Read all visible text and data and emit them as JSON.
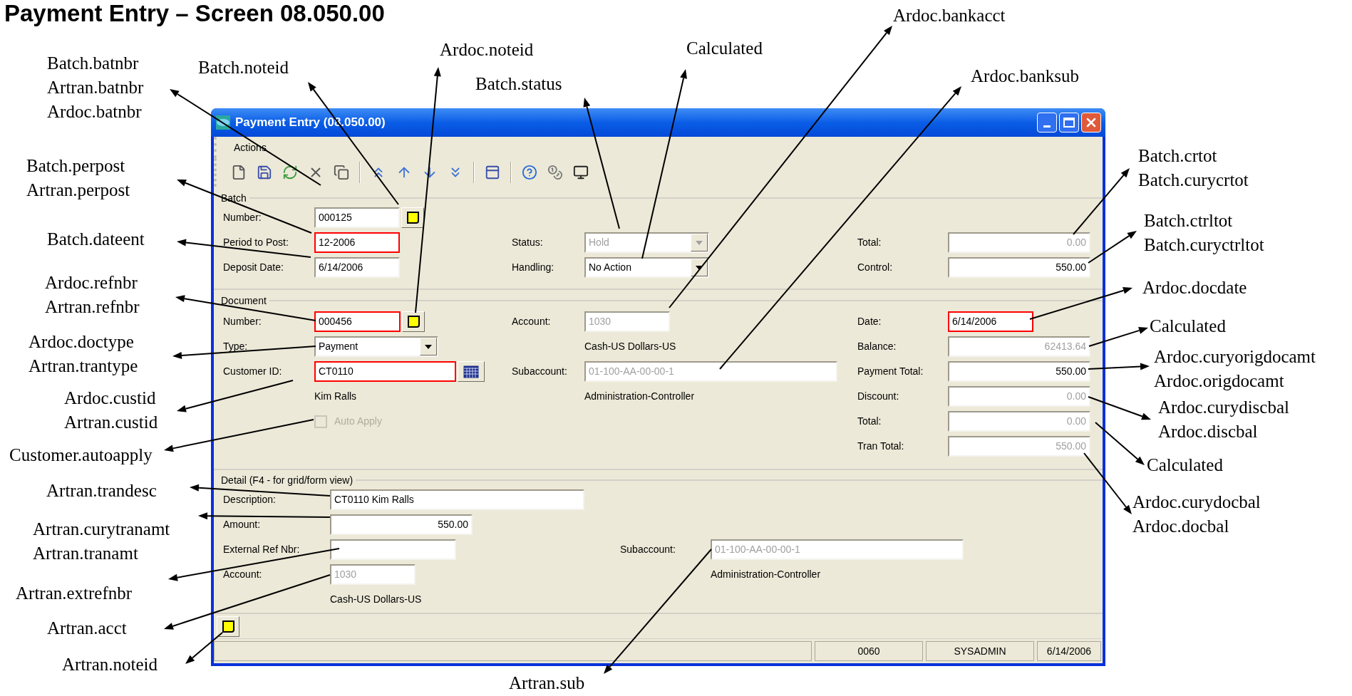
{
  "title": "Payment Entry – Screen 08.050.00",
  "window": {
    "title": "Payment Entry (08.050.00)",
    "menu": [
      "Actions"
    ],
    "groups": [
      {
        "label": "Batch",
        "columns": [
          [
            {
              "kind": "text",
              "label": "Number:",
              "value": "000125",
              "required": false,
              "disabled": false,
              "note_button": true
            },
            {
              "kind": "text",
              "label": "Period to Post:",
              "value": "12-2006",
              "required": true,
              "disabled": false
            },
            {
              "kind": "text",
              "label": "Deposit Date:",
              "value": "6/14/2006",
              "required": false,
              "disabled": false
            }
          ],
          [
            {
              "kind": "select",
              "label": "Status:",
              "value": "Hold",
              "required": false,
              "disabled": true
            },
            {
              "kind": "select",
              "label": "Handling:",
              "value": "No Action",
              "required": false,
              "disabled": false
            }
          ],
          [
            {
              "kind": "text",
              "label": "Total:",
              "value": "0.00",
              "required": false,
              "disabled": true
            },
            {
              "kind": "text",
              "label": "Control:",
              "value": "550.00",
              "required": false,
              "disabled": false
            }
          ]
        ]
      },
      {
        "label": "Document",
        "columns": [
          [
            {
              "kind": "text",
              "label": "Number:",
              "value": "000456",
              "required": true,
              "disabled": false,
              "note_button": true
            },
            {
              "kind": "select",
              "label": "Type:",
              "value": "Payment",
              "required": false,
              "disabled": false
            },
            {
              "kind": "text",
              "label": "Customer ID:",
              "value": "CT0110",
              "required": true,
              "disabled": false,
              "lookup_button": true,
              "description": "Kim Ralls"
            },
            {
              "kind": "checkbox",
              "label": "Auto Apply",
              "checked": false,
              "disabled": true
            }
          ],
          [
            {
              "kind": "text",
              "label": "Account:",
              "value": "1030",
              "required": false,
              "disabled": true,
              "description": "Cash-US Dollars-US"
            },
            {
              "kind": "text",
              "label": "Subaccount:",
              "value": "01-100-AA-00-00-1",
              "required": false,
              "disabled": true,
              "description": "Administration-Controller"
            }
          ],
          [
            {
              "kind": "text",
              "label": "Date:",
              "value": "6/14/2006",
              "required": true,
              "disabled": false
            },
            {
              "kind": "text",
              "label": "Balance:",
              "value": "62413.64",
              "required": false,
              "disabled": true
            },
            {
              "kind": "text",
              "label": "Payment Total:",
              "value": "550.00",
              "required": false,
              "disabled": false
            },
            {
              "kind": "text",
              "label": "Discount:",
              "value": "0.00",
              "required": false,
              "disabled": true
            },
            {
              "kind": "text",
              "label": "Total:",
              "value": "0.00",
              "required": false,
              "disabled": true
            },
            {
              "kind": "text",
              "label": "Tran Total:",
              "value": "550.00",
              "required": false,
              "disabled": true
            }
          ]
        ]
      },
      {
        "label": "Detail (F4 - for grid/form view)",
        "columns": [
          [
            {
              "kind": "text",
              "label": "Description:",
              "value": "CT0110 Kim Ralls",
              "required": false,
              "disabled": false
            },
            {
              "kind": "text",
              "label": "Amount:",
              "value": "550.00",
              "required": false,
              "disabled": false
            },
            {
              "kind": "text",
              "label": "External Ref Nbr:",
              "required": false
            },
            {
              "kind": "text",
              "label": "Account:",
              "value": "1030",
              "required": false,
              "disabled": true,
              "description": "Cash-US Dollars-US"
            }
          ],
          [
            {
              "kind": "text",
              "label": "Subaccount:",
              "value": "01-100-AA-00-00-1",
              "required": false,
              "disabled": true,
              "description": "Administration-Controller"
            }
          ]
        ]
      }
    ],
    "status_bar": [
      "0060",
      "SYSADMIN",
      "6/14/2006"
    ]
  },
  "annotations": [
    {
      "lines": [
        "Batch.batnbr",
        "Artran.batnbr",
        "Ardoc.batnbr"
      ]
    },
    {
      "lines": [
        "Batch.noteid"
      ]
    },
    {
      "lines": [
        "Ardoc.noteid"
      ]
    },
    {
      "lines": [
        "Calculated"
      ]
    },
    {
      "lines": [
        "Ardoc.bankacct"
      ]
    },
    {
      "lines": [
        "Batch.status"
      ]
    },
    {
      "lines": [
        "Ardoc.banksub"
      ]
    },
    {
      "lines": [
        "Batch.perpost",
        "Artran.perpost"
      ]
    },
    {
      "lines": [
        "Batch.crtot",
        "Batch.curycrtot"
      ]
    },
    {
      "lines": [
        "Batch.dateent"
      ]
    },
    {
      "lines": [
        "Batch.ctrltot",
        "Batch.curyctrltot"
      ]
    },
    {
      "lines": [
        "Ardoc.refnbr",
        "Artran.refnbr"
      ]
    },
    {
      "lines": [
        "Ardoc.docdate"
      ]
    },
    {
      "lines": [
        "Ardoc.doctype",
        "Artran.trantype"
      ]
    },
    {
      "lines": [
        "Calculated"
      ]
    },
    {
      "lines": [
        "Ardoc.curyorigdocamt",
        "Ardoc.origdocamt"
      ]
    },
    {
      "lines": [
        "Ardoc.custid",
        "Artran.custid"
      ]
    },
    {
      "lines": [
        "Ardoc.curydiscbal",
        "Ardoc.discbal"
      ]
    },
    {
      "lines": [
        "Customer.autoapply"
      ]
    },
    {
      "lines": [
        "Calculated"
      ]
    },
    {
      "lines": [
        "Artran.trandesc"
      ]
    },
    {
      "lines": [
        "Ardoc.curydocbal",
        "Ardoc.docbal"
      ]
    },
    {
      "lines": [
        "Artran.curytranamt",
        "Artran.tranamt"
      ]
    },
    {
      "lines": [
        "Artran.extrefnbr"
      ]
    },
    {
      "lines": [
        "Artran.acct"
      ]
    },
    {
      "lines": [
        "Artran.noteid"
      ]
    },
    {
      "lines": [
        "Artran.sub"
      ]
    }
  ]
}
